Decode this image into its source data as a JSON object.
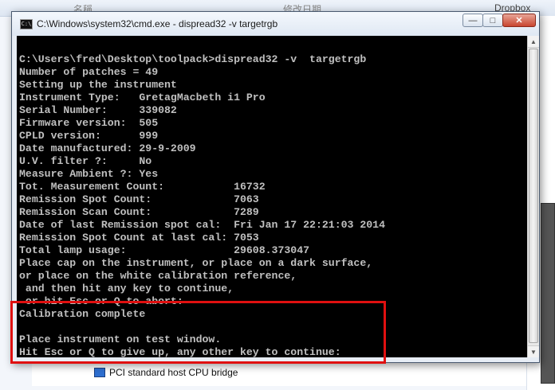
{
  "background": {
    "top_texts": [
      "名稱",
      "修改日期",
      "Dropbox"
    ],
    "device_item": "PCI standard host CPU bridge"
  },
  "cmd_window": {
    "icon_text": "C:\\",
    "title": "C:\\Windows\\system32\\cmd.exe - dispread32  -v  targetrgb",
    "min_symbol": "—",
    "max_symbol": "□",
    "close_symbol": "✕"
  },
  "console": {
    "lines": [
      "C:\\Users\\fred\\Desktop\\toolpack>dispread32 -v  targetrgb",
      "Number of patches = 49",
      "Setting up the instrument",
      "Instrument Type:   GretagMacbeth i1 Pro",
      "Serial Number:     339082",
      "Firmware version:  505",
      "CPLD version:      999",
      "Date manufactured: 29-9-2009",
      "U.V. filter ?:     No",
      "Measure Ambient ?: Yes",
      "Tot. Measurement Count:           16732",
      "Remission Spot Count:             7063",
      "Remission Scan Count:             7289",
      "Date of last Remission spot cal:  Fri Jan 17 22:21:03 2014",
      "Remission Spot Count at last cal: 7053",
      "Total lamp usage:                 29608.373047",
      "Place cap on the instrument, or place on a dark surface,",
      "or place on the white calibration reference,",
      " and then hit any key to continue,",
      " or hit Esc or Q to abort:",
      "Calibration complete",
      "",
      "Place instrument on test window.",
      "Hit Esc or Q to give up, any other key to continue:"
    ]
  },
  "colors": {
    "console_bg": "#000000",
    "console_text": "#c0c0c0",
    "highlight": "#e01010"
  }
}
